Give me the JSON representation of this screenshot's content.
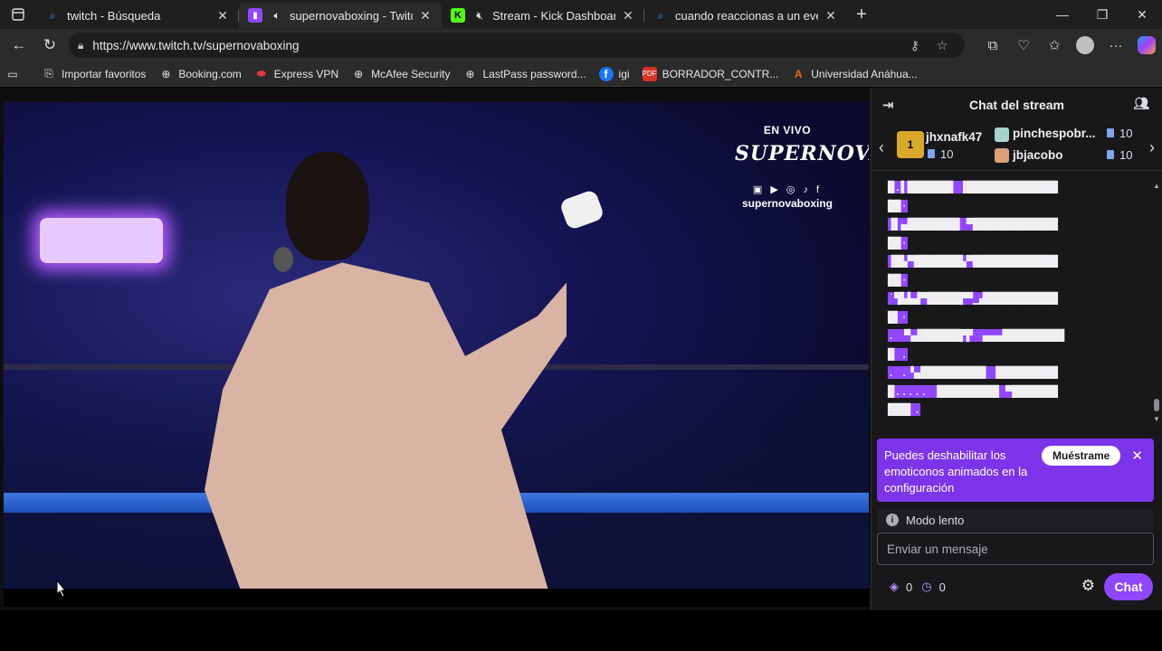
{
  "browser": {
    "tabs": [
      {
        "title": "twitch - Búsqueda",
        "favicon": "search-icon"
      },
      {
        "title": "supernovaboxing - Twitch",
        "favicon": "twitch-icon"
      },
      {
        "title": "Stream - Kick Dashboard",
        "favicon": "kick-icon"
      },
      {
        "title": "cuando reaccionas a un evento en",
        "favicon": "search-icon"
      }
    ],
    "url": "https://www.twitch.tv/supernovaboxing",
    "bookmarks": [
      {
        "label": "Importar favoritos"
      },
      {
        "label": "Booking.com"
      },
      {
        "label": "Express VPN"
      },
      {
        "label": "McAfee Security"
      },
      {
        "label": "LastPass password..."
      },
      {
        "label": "igi"
      },
      {
        "label": "BORRADOR_CONTR..."
      },
      {
        "label": "Universidad Anáhua..."
      }
    ]
  },
  "video": {
    "live_label": "EN VIVO",
    "brand": "SUPERNOVA",
    "handle": "supernovaboxing"
  },
  "chat": {
    "title": "Chat del stream",
    "gifters": [
      {
        "name": "jhxnafk47",
        "count": "10"
      },
      {
        "name": "pinchespobr...",
        "count": "10"
      },
      {
        "name": "jbjacobo",
        "count": "10"
      }
    ],
    "ascii_lines": [
      "█.▌███████ ▐██████████████",
      "██·",
      "▐▌▄████████ ▀█████████████",
      "██·",
      "▐█▙▀███████▙▀█████████████",
      "██·",
      "˙▜▙▙▟▀█████▛▀▁▟███████████",
      "█▌·",
      ". ▝▚▟██████▛▛ ▗▄▄▟█████████",
      "█ .",
      ". .▝▄██████████ ▐█████████",
      "█..... ▐█████████ ▀███████",
      "███▌."
    ],
    "notice": {
      "text": "Puedes deshabilitar los emoticonos animados en la configuración",
      "button": "Muéstrame"
    },
    "slow_mode": "Modo lento",
    "input_placeholder": "Enviar un mensaje",
    "points_a": "0",
    "points_b": "0",
    "send_label": "Chat"
  },
  "colors": {
    "twitch_purple": "#9147ff",
    "kick_green": "#53fc18"
  }
}
